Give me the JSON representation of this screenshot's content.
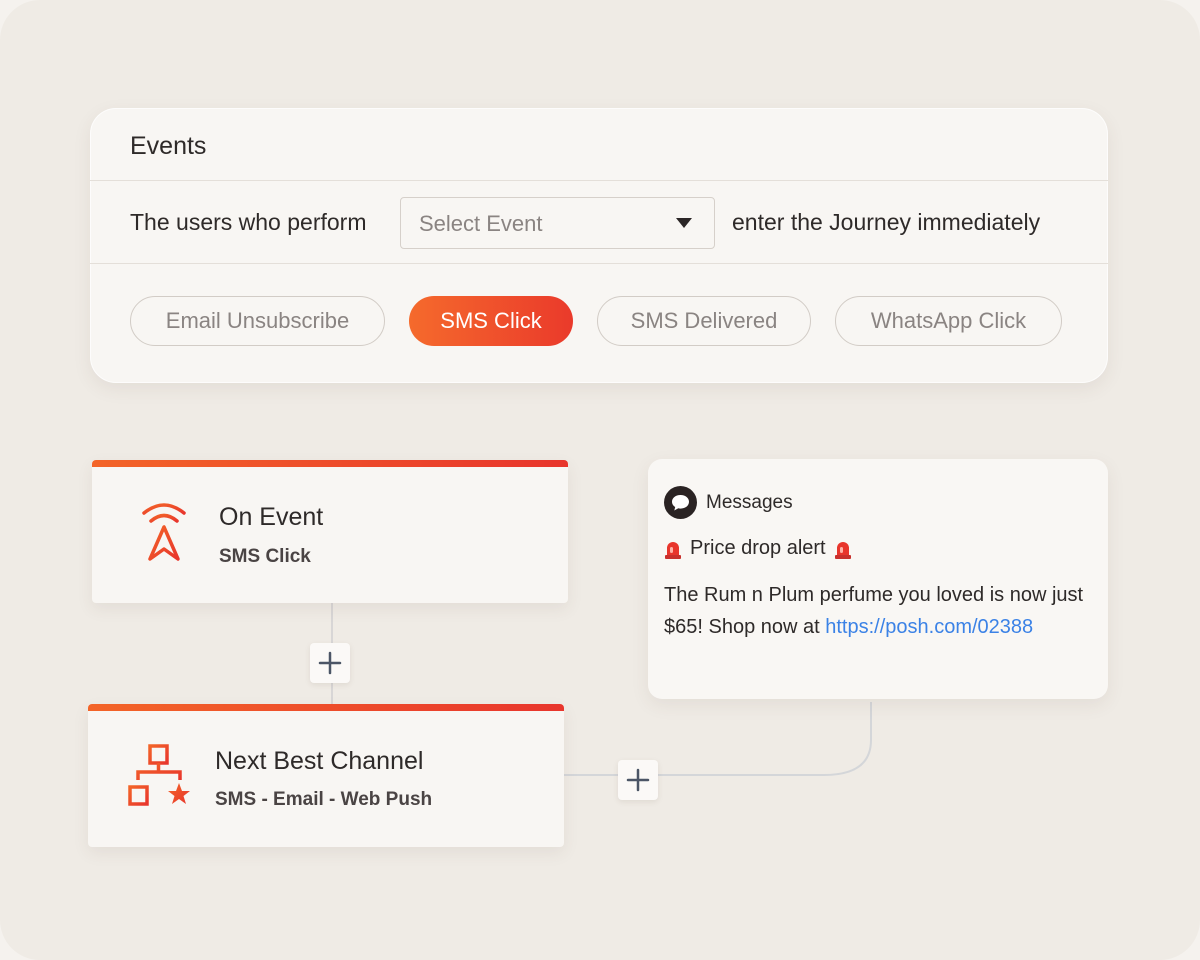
{
  "events": {
    "title": "Events",
    "rule_prefix": "The users who perform",
    "select_placeholder": "Select Event",
    "rule_suffix": "enter the Journey immediately",
    "chips": [
      {
        "label": "Email Unsubscribe",
        "active": false
      },
      {
        "label": "SMS Click",
        "active": true
      },
      {
        "label": "SMS Delivered",
        "active": false
      },
      {
        "label": "WhatsApp Click",
        "active": false
      }
    ]
  },
  "flow": {
    "on_event": {
      "title": "On Event",
      "subtitle": "SMS Click",
      "icon": "location-signal-icon"
    },
    "next_best_channel": {
      "title": "Next Best Channel",
      "subtitle": "SMS - Email - Web Push",
      "icon": "channel-tree-icon"
    }
  },
  "message": {
    "app_name": "Messages",
    "alert": "Price drop alert",
    "body": "The Rum n Plum perfume you loved is now just $65! Shop now at",
    "link": "https://posh.com/02388"
  },
  "colors": {
    "accent_start": "#f56a2c",
    "accent_end": "#ea3a2b",
    "link": "#3b82e6"
  }
}
